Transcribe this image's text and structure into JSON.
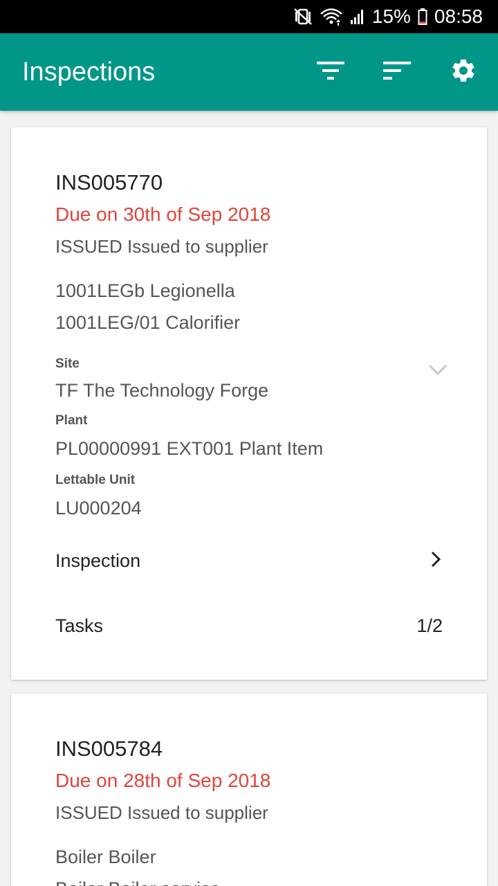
{
  "status_bar": {
    "battery": "15%",
    "time": "08:58",
    "icons": [
      "mute-vibrate-icon",
      "wifi-icon",
      "signal-icon",
      "battery-icon"
    ]
  },
  "app_bar": {
    "title": "Inspections",
    "actions": [
      "filter-icon",
      "sort-icon",
      "settings-icon"
    ],
    "color": "#009688"
  },
  "cards": [
    {
      "id": "INS005770",
      "due": "Due on 30th of Sep 2018",
      "status": "ISSUED Issued to supplier",
      "line1": "1001LEGb Legionella",
      "line2": "1001LEG/01 Calorifier",
      "fields": [
        {
          "label": "Site",
          "value": "TF The Technology Forge"
        },
        {
          "label": "Plant",
          "value": "PL00000991 EXT001 Plant Item"
        },
        {
          "label": "Lettable Unit",
          "value": "LU000204"
        }
      ],
      "inspection_label": "Inspection",
      "tasks_label": "Tasks",
      "tasks_value": "1/2"
    },
    {
      "id": "INS005784",
      "due": "Due on 28th of Sep 2018",
      "status": "ISSUED Issued to supplier",
      "line1": "Boiler Boiler",
      "line2": "Boiler Boiler service"
    }
  ],
  "colors": {
    "due": "#e0443a",
    "accent": "#009688"
  }
}
